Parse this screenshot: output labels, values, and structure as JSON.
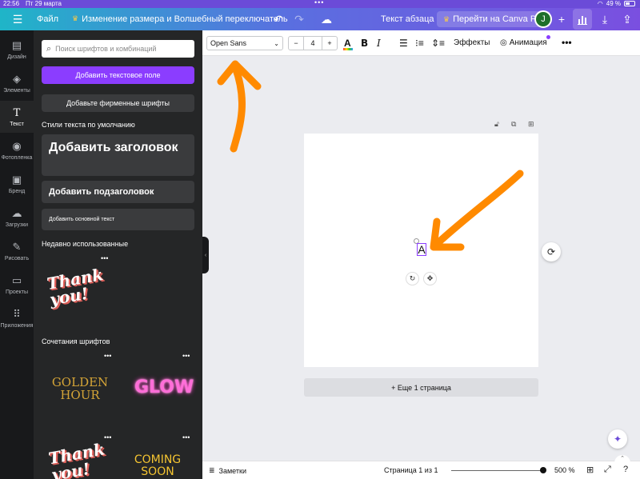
{
  "status_bar": {
    "time": "22:56",
    "date": "Пт 29 марта",
    "battery": "49 %"
  },
  "topbar": {
    "file_label": "Файл",
    "doc_title": "Изменение размера и Волшебный переключатель",
    "text_type": "Текст абзаца",
    "pro_label": "Перейти на Canva Pro",
    "avatar_letter": "J"
  },
  "rail": [
    {
      "label": "Дизайн",
      "icon": "layout-icon"
    },
    {
      "label": "Элементы",
      "icon": "elements-icon"
    },
    {
      "label": "Текст",
      "icon": "text-icon",
      "active": true
    },
    {
      "label": "Фотопленка",
      "icon": "camera-icon"
    },
    {
      "label": "Бренд",
      "icon": "brand-icon"
    },
    {
      "label": "Загрузки",
      "icon": "upload-icon"
    },
    {
      "label": "Рисовать",
      "icon": "draw-icon"
    },
    {
      "label": "Проекты",
      "icon": "folder-icon"
    },
    {
      "label": "Приложения",
      "icon": "apps-icon"
    }
  ],
  "panel": {
    "search_placeholder": "Поиск шрифтов и комбинаций",
    "add_text_button": "Добавить текстовое поле",
    "brand_fonts_button": "Добавьте фирменные шрифты",
    "default_styles_title": "Стили текста по умолчанию",
    "heading_card": "Добавить заголовок",
    "subheading_card": "Добавить подзаголовок",
    "body_card": "Добавить основной текст",
    "recent_title": "Недавно использованные",
    "recent_thumb_text": "Thank you!",
    "combos_title": "Сочетания шрифтов",
    "combo_1": "GOLDEN HOUR",
    "combo_2": "GLOW",
    "combo_3": "Thank you!",
    "combo_4": "COMING SOON"
  },
  "toolbar": {
    "font_name": "Open Sans",
    "font_size": "4",
    "effects_label": "Эффекты",
    "animation_label": "Анимация"
  },
  "canvas": {
    "selected_text": "A",
    "add_page_label": "+ Еще 1 страница"
  },
  "bottombar": {
    "notes_label": "Заметки",
    "page_indicator": "Страница 1 из 1",
    "zoom_level": "500 %",
    "zoom_fraction": 0.98
  },
  "colors": {
    "accent": "#8b3dff",
    "annotation_arrow": "#ff8a00",
    "rail_bg": "#18191b",
    "panel_bg": "#252627"
  }
}
